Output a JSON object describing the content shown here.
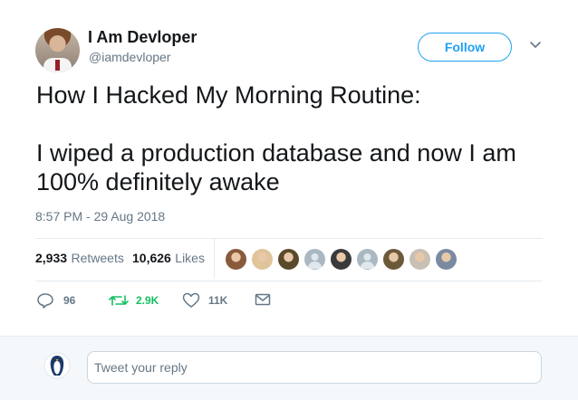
{
  "author": {
    "name": "I Am Devloper",
    "handle": "@iamdevloper",
    "follow_label": "Follow"
  },
  "tweet": {
    "text": "How I Hacked My Morning Routine:\n\nI wiped a production database and now I am 100% definitely awake",
    "timestamp": "8:57 PM - 29 Aug 2018"
  },
  "stats": {
    "retweets_count": "2,933",
    "retweets_label": "Retweets",
    "likes_count": "10,626",
    "likes_label": "Likes"
  },
  "likers": [
    {
      "icon": "avatar-1",
      "color": "#8a5a3c"
    },
    {
      "icon": "avatar-2",
      "color": "#e0c49a"
    },
    {
      "icon": "avatar-3",
      "color": "#5a4a2a"
    },
    {
      "icon": "avatar-default",
      "color": "#aab8c2"
    },
    {
      "icon": "avatar-5",
      "color": "#3a3a3a"
    },
    {
      "icon": "avatar-default",
      "color": "#aab8c2"
    },
    {
      "icon": "avatar-7",
      "color": "#6b5a3a"
    },
    {
      "icon": "avatar-8",
      "color": "#c9c0b5"
    },
    {
      "icon": "avatar-9",
      "color": "#7a8aa0"
    }
  ],
  "actions": {
    "reply_count": "96",
    "retweet_count": "2.9K",
    "like_count": "11K"
  },
  "reply": {
    "placeholder": "Tweet your reply"
  },
  "colors": {
    "accent": "#1da1f2",
    "retweet_green": "#17bf63",
    "muted": "#657786"
  }
}
